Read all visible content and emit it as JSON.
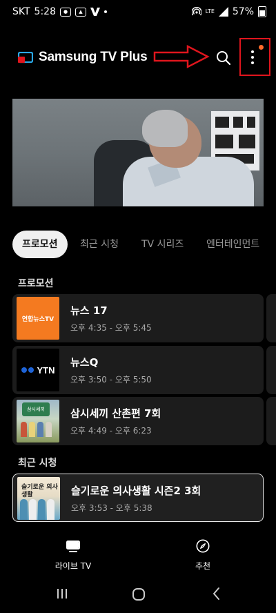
{
  "status_bar": {
    "carrier": "SKT",
    "time": "5:28",
    "network_label": "LTE",
    "battery_percent": "57%"
  },
  "header": {
    "brand": "Samsung TV Plus",
    "search_icon": "search-icon",
    "menu_icon": "more-vertical-icon",
    "accent_color": "#e0151d",
    "notification_color": "#ff6b2b"
  },
  "tabs": [
    {
      "label": "프로모션",
      "active": true
    },
    {
      "label": "최근 시청",
      "active": false
    },
    {
      "label": "TV 시리즈",
      "active": false
    },
    {
      "label": "엔터테인먼트",
      "active": false
    }
  ],
  "sections": {
    "promotion": {
      "title": "프로모션",
      "items": [
        {
          "thumb_text": "연합뉴스TV",
          "title": "뉴스 17",
          "time": "오후 4:35 - 오후 5:45"
        },
        {
          "thumb_text": "YTN",
          "title": "뉴스Q",
          "time": "오후 3:50 - 오후 5:50"
        },
        {
          "thumb_text": "삼시세끼",
          "title": "삼시세끼 산촌편 7회",
          "time": "오후 4:49 - 오후 6:23"
        }
      ]
    },
    "recent": {
      "title": "최근 시청",
      "items": [
        {
          "thumb_text": "슬기로운 의사생활",
          "title": "슬기로운 의사생활 시즌2 3회",
          "time": "오후 3:53 - 오후 5:38"
        }
      ]
    }
  },
  "bottom_nav": [
    {
      "label": "라이브 TV",
      "icon": "tv-icon"
    },
    {
      "label": "추천",
      "icon": "compass-icon"
    }
  ],
  "system_nav": [
    "recents-icon",
    "home-icon",
    "back-icon"
  ]
}
